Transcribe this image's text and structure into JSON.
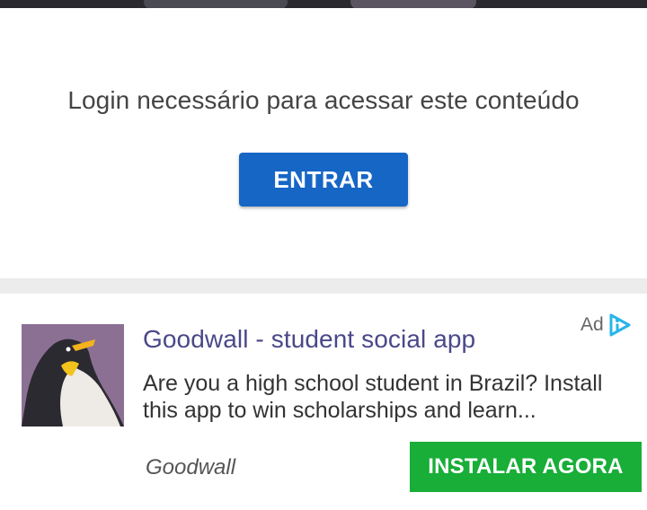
{
  "login": {
    "message": "Login necessário para acessar este conteúdo",
    "enter_label": "ENTRAR"
  },
  "ad": {
    "badge_label": "Ad",
    "title": "Goodwall - student social app",
    "body": "Are you a high school student in Brazil? Install this app to win scholarships and learn...",
    "advertiser": "Goodwall",
    "cta_label": "INSTALAR AGORA",
    "image_icon": "penguin-icon",
    "badge_icon": "adchoices-icon"
  },
  "colors": {
    "enter_button": "#1666c5",
    "install_button": "#18ae38",
    "ad_title": "#4a4888",
    "ad_image_background": "#8b7094"
  }
}
